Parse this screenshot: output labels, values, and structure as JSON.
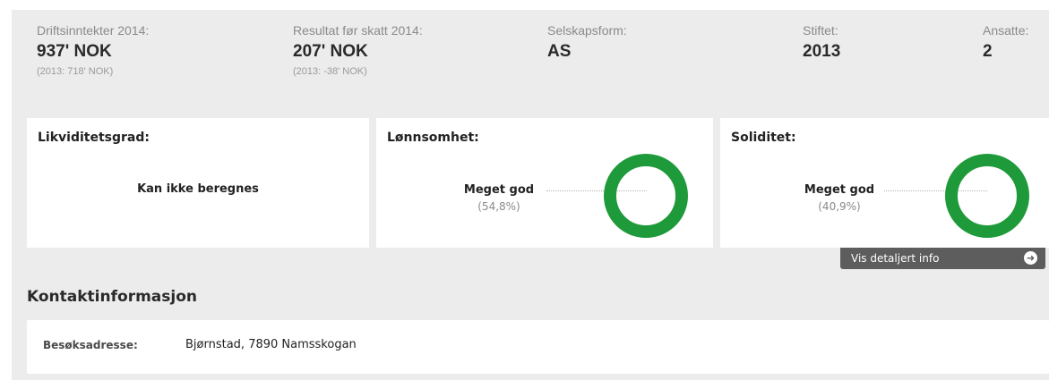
{
  "stats": [
    {
      "label": "Driftsinntekter 2014:",
      "value": "937' NOK",
      "sub": "(2013: 718' NOK)"
    },
    {
      "label": "Resultat før skatt 2014:",
      "value": "207' NOK",
      "sub": "(2013: -38' NOK)"
    },
    {
      "label": "Selskapsform:",
      "value": "AS",
      "sub": ""
    },
    {
      "label": "Stiftet:",
      "value": "2013",
      "sub": ""
    },
    {
      "label": "Ansatte:",
      "value": "2",
      "sub": ""
    }
  ],
  "cards": {
    "likviditet": {
      "title": "Likviditetsgrad:",
      "text": "Kan ikke beregnes"
    },
    "lonnsomhet": {
      "title": "Lønnsomhet:",
      "rating": "Meget god",
      "percent": "(54,8%)",
      "ring_color": "#1f9a3a"
    },
    "soliditet": {
      "title": "Soliditet:",
      "rating": "Meget god",
      "percent": "(40,9%)",
      "ring_color": "#1f9a3a"
    }
  },
  "detail_button": {
    "label": "Vis detaljert info",
    "icon": "arrow-right-circle-icon"
  },
  "contact": {
    "title": "Kontaktinformasjon",
    "address_label": "Besøksadresse:",
    "address_value": "Bjørnstad, 7890 Namsskogan"
  }
}
